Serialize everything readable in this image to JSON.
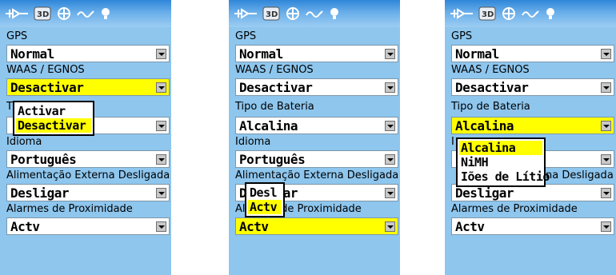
{
  "colors": {
    "screen_bg": "#8ec6ee",
    "titlebar": "#2f86d8",
    "highlight": "#ffff00",
    "field_bg": "#ffffff"
  },
  "toolbar_icons": [
    "track-log-icon",
    "3d-view-icon",
    "satellite-icon",
    "waypoint-path-icon",
    "light-bulb-icon"
  ],
  "screens": [
    {
      "gps_label": "GPS",
      "gps_value": "Normal",
      "waas_label": "WAAS / EGNOS",
      "waas_value": "Desactivar",
      "battery_label": "Ti",
      "battery_value": "",
      "language_label": "Idioma",
      "language_value": "Português",
      "ext_power_label": "Alimentação Externa Desligada",
      "ext_power_value": "Desligar",
      "proximity_label": "Alarmes de Proximidade",
      "proximity_value": "Actv",
      "popup_options": [
        "Activar",
        "Desactivar"
      ]
    },
    {
      "gps_label": "GPS",
      "gps_value": "Normal",
      "waas_label": "WAAS / EGNOS",
      "waas_value": "Desactivar",
      "battery_label": "Tipo de Bateria",
      "battery_value": "Alcalina",
      "language_label": "Idioma",
      "language_value": "Português",
      "ext_power_label": "Alimentação Externa Desligada",
      "ext_power_value": "Desligar",
      "proximity_label": "Alarmes de Proximidade",
      "proximity_value": "Actv",
      "popup_options": [
        "Desl",
        "Actv"
      ]
    },
    {
      "gps_label": "GPS",
      "gps_value": "Normal",
      "waas_label": "WAAS / EGNOS",
      "waas_value": "Desactivar",
      "battery_label": "Tipo de Bateria",
      "battery_value": "Alcalina",
      "language_label": "I",
      "language_value": "",
      "ext_power_label": "na Desligada",
      "ext_power_value": "Desligar",
      "proximity_label": "Alarmes de Proximidade",
      "proximity_value": "Actv",
      "popup_options": [
        "Alcalina",
        "NiMH",
        "Iões de Lítio"
      ]
    }
  ]
}
